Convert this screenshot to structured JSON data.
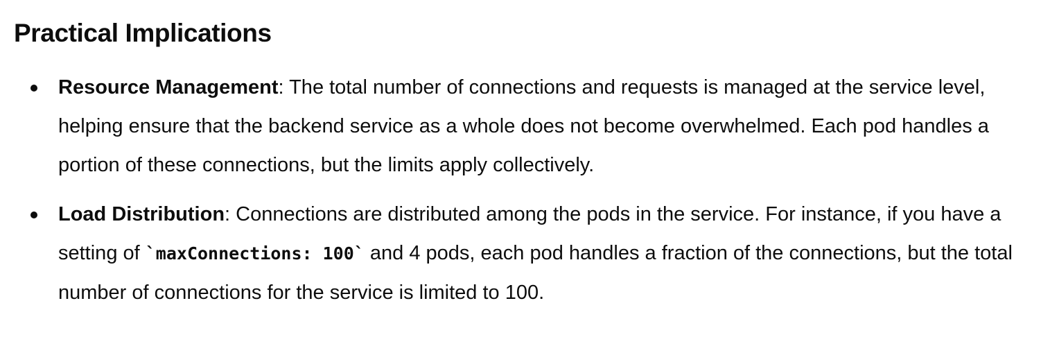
{
  "heading": "Practical Implications",
  "bullets": [
    {
      "term": "Resource Management",
      "separator": ":",
      "text": " The total number of connections and requests is managed at the service level, helping ensure that the backend service as a whole does not become overwhelmed. Each pod handles a portion of these connections, but the limits apply collectively."
    },
    {
      "term": "Load Distribution",
      "separator": ":",
      "text_before_code": " Connections are distributed among the pods in the service. For instance, if you have a setting of ",
      "code": "`maxConnections: 100`",
      "text_after_code": " and 4 pods, each pod handles a fraction of the connections, but the total number of connections for the service is limited to 100."
    }
  ]
}
